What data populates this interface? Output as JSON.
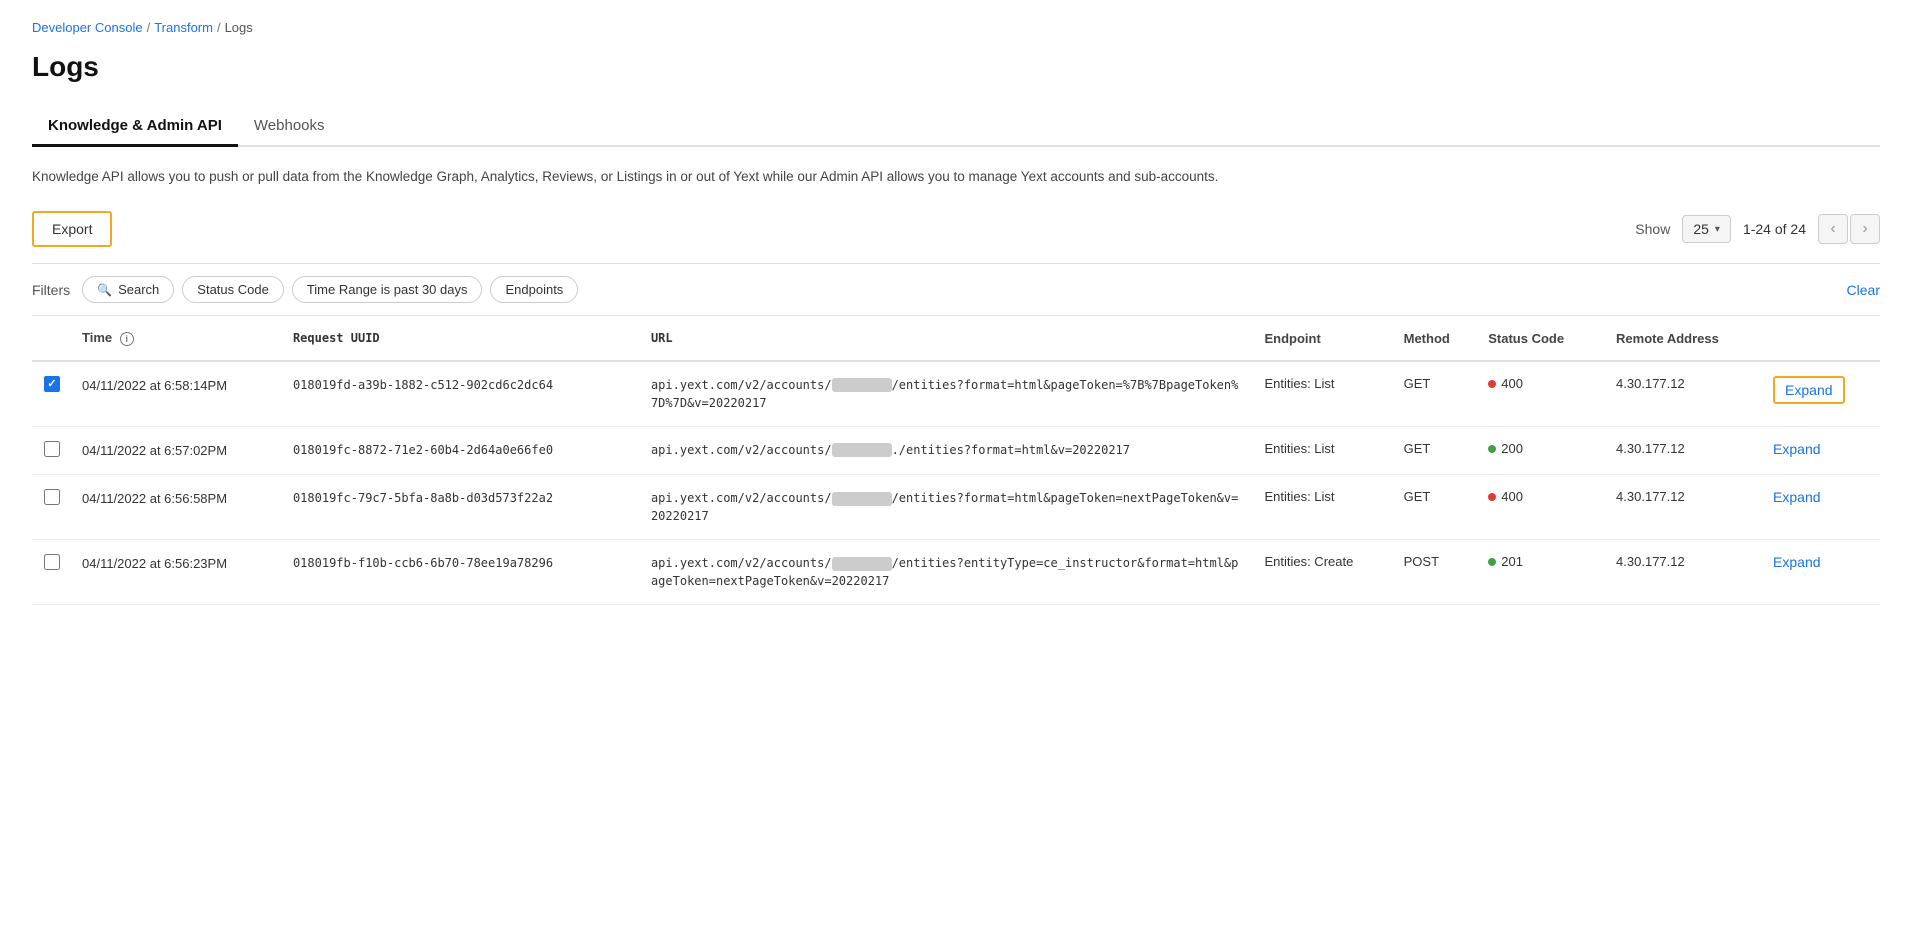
{
  "breadcrumb": {
    "items": [
      {
        "label": "Developer Console",
        "href": "#"
      },
      {
        "label": "Transform",
        "href": "#"
      },
      {
        "label": "Logs",
        "current": true
      }
    ]
  },
  "page": {
    "title": "Logs"
  },
  "tabs": [
    {
      "id": "knowledge",
      "label": "Knowledge & Admin API",
      "active": true
    },
    {
      "id": "webhooks",
      "label": "Webhooks",
      "active": false
    }
  ],
  "description": "Knowledge API allows you to push or pull data from the Knowledge Graph, Analytics, Reviews, or Listings in or out of Yext while our Admin API allows you to manage Yext accounts and sub-accounts.",
  "toolbar": {
    "export_label": "Export",
    "show_label": "Show",
    "show_value": "25",
    "page_info": "1-24 of 24",
    "prev_label": "‹",
    "next_label": "›"
  },
  "filters": {
    "label": "Filters",
    "chips": [
      {
        "id": "search",
        "label": "Search",
        "has_icon": true
      },
      {
        "id": "status_code",
        "label": "Status Code"
      },
      {
        "id": "time_range",
        "label": "Time Range is past 30 days"
      },
      {
        "id": "endpoints",
        "label": "Endpoints"
      }
    ],
    "clear_label": "Clear"
  },
  "table": {
    "columns": [
      {
        "id": "checkbox",
        "label": ""
      },
      {
        "id": "time",
        "label": "Time",
        "has_info": true
      },
      {
        "id": "uuid",
        "label": "Request UUID"
      },
      {
        "id": "url",
        "label": "URL"
      },
      {
        "id": "endpoint",
        "label": "Endpoint"
      },
      {
        "id": "method",
        "label": "Method"
      },
      {
        "id": "status_code",
        "label": "Status Code"
      },
      {
        "id": "remote_address",
        "label": "Remote Address"
      },
      {
        "id": "expand",
        "label": ""
      }
    ],
    "rows": [
      {
        "id": "row1",
        "checked": true,
        "time": "04/11/2022 at 6:58:14PM",
        "uuid": "018019fd-a39b-1882-c512-902cd6c2dc64",
        "url": "api.yext.com/v2/accounts/[REDACTED]/entities?format=html&pageToken=%7B%7BpageToken%7D%7D&v=20220217",
        "endpoint": "Entities: List",
        "method": "GET",
        "status_code": "400",
        "status_type": "error",
        "remote_address": "4.30.177.12",
        "expand_label": "Expand",
        "expand_highlighted": true
      },
      {
        "id": "row2",
        "checked": false,
        "time": "04/11/2022 at 6:57:02PM",
        "uuid": "018019fc-8872-71e2-60b4-2d64a0e66fe0",
        "url": "api.yext.com/v2/accounts/[REDACTED]./entities?format=html&v=20220217",
        "endpoint": "Entities: List",
        "method": "GET",
        "status_code": "200",
        "status_type": "success",
        "remote_address": "4.30.177.12",
        "expand_label": "Expand",
        "expand_highlighted": false
      },
      {
        "id": "row3",
        "checked": false,
        "time": "04/11/2022 at 6:56:58PM",
        "uuid": "018019fc-79c7-5bfa-8a8b-d03d573f22a2",
        "url": "api.yext.com/v2/accounts/[REDACTED]/entities?format=html&pageToken=nextPageToken&v=20220217",
        "endpoint": "Entities: List",
        "method": "GET",
        "status_code": "400",
        "status_type": "error",
        "remote_address": "4.30.177.12",
        "expand_label": "Expand",
        "expand_highlighted": false
      },
      {
        "id": "row4",
        "checked": false,
        "time": "04/11/2022 at 6:56:23PM",
        "uuid": "018019fb-f10b-ccb6-6b70-78ee19a78296",
        "url": "api.yext.com/v2/accounts/[REDACTED]/entities?entityType=ce_instructor&format=html&pageToken=nextPageToken&v=20220217",
        "endpoint": "Entities: Create",
        "method": "POST",
        "status_code": "201",
        "status_type": "success",
        "remote_address": "4.30.177.12",
        "expand_label": "Expand",
        "expand_highlighted": false
      }
    ]
  },
  "colors": {
    "accent": "#f5a623",
    "link": "#1a73e8",
    "error": "#e53935",
    "success": "#43a047"
  }
}
